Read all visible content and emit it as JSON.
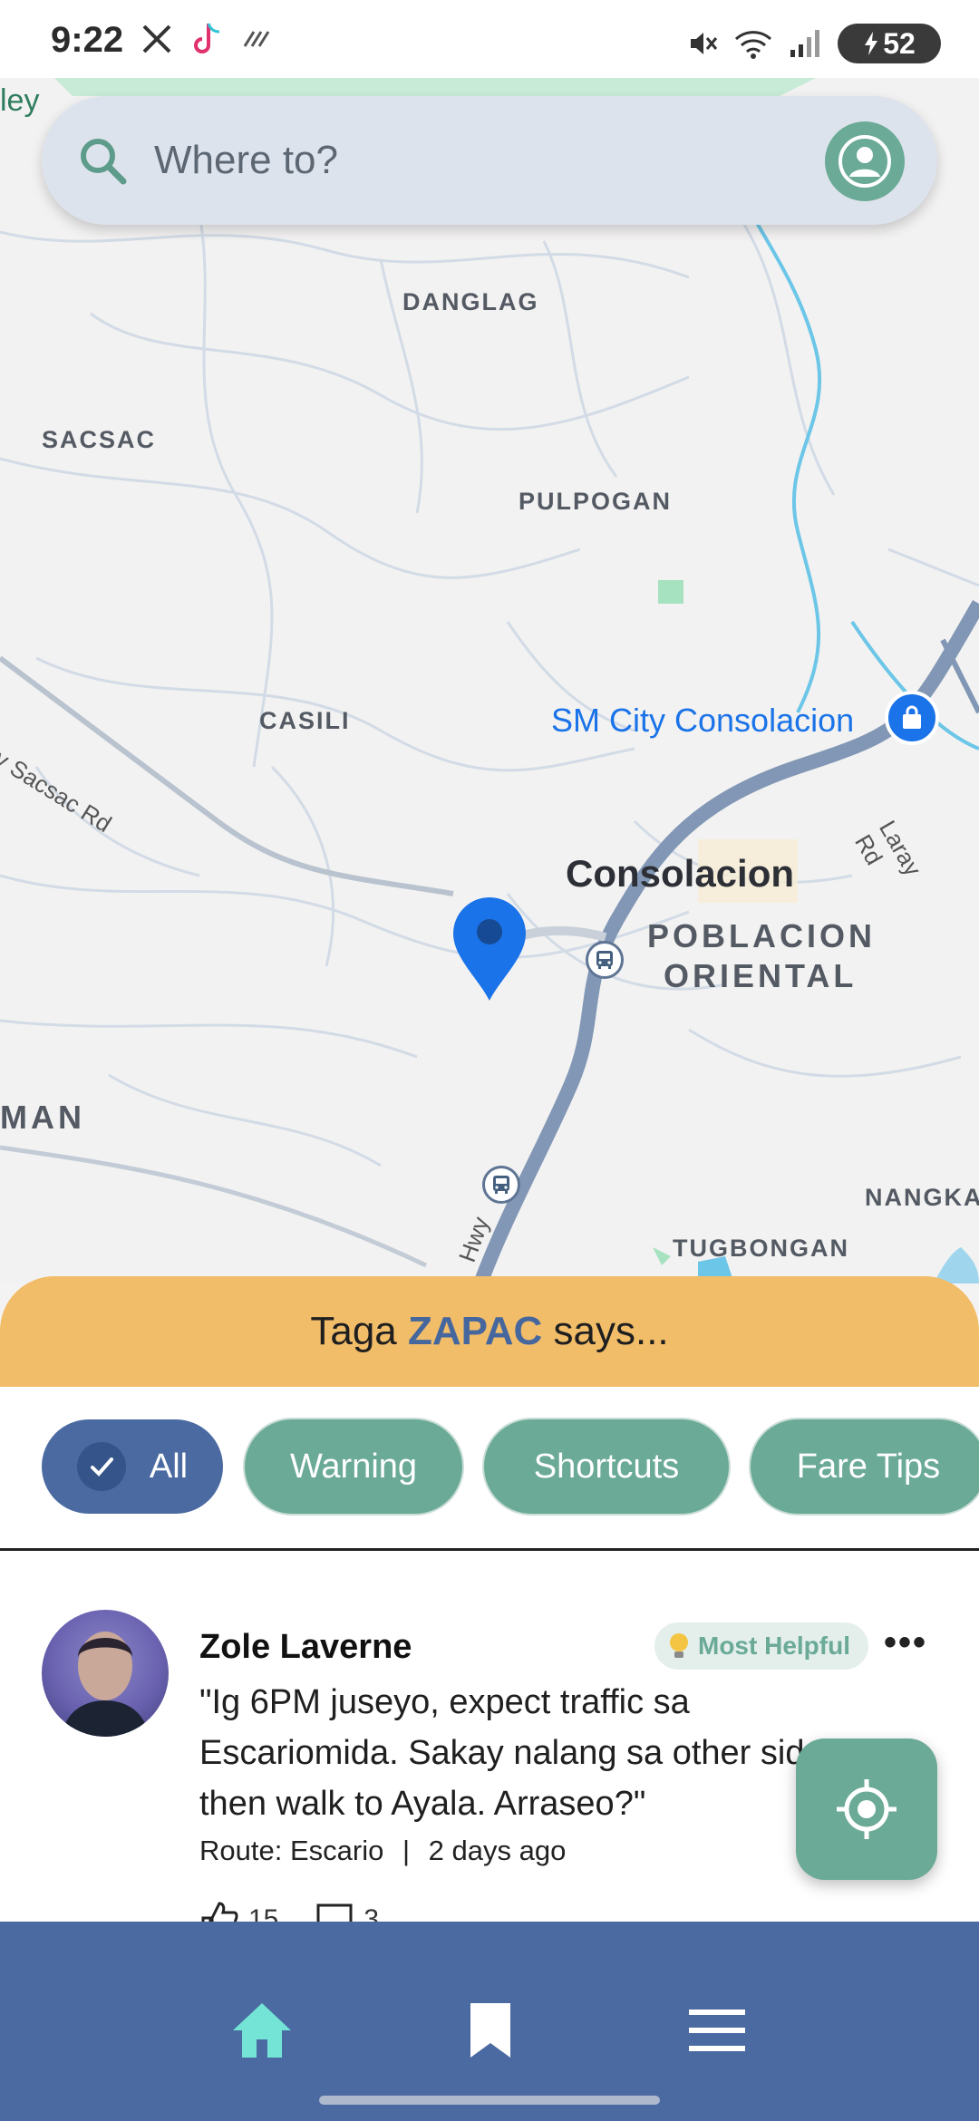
{
  "status_bar": {
    "time": "9:22",
    "battery": "52"
  },
  "search": {
    "placeholder": "Where to?"
  },
  "map": {
    "labels": {
      "valley": "ley",
      "danglag": "DANGLAG",
      "sacsac": "SACSAC",
      "pulpogan": "PULPOGAN",
      "casili": "CASILI",
      "sm_city": "SM City Consolacion",
      "sacsac_rd": "nay Sacsac Rd",
      "consolacion": "Consolacion",
      "poblacion": "POBLACION",
      "oriental": "ORIENTAL",
      "laray_rd": "Laray Rd",
      "man": "MAN",
      "nangka": "NANGKA",
      "tugbongan": "TUGBONGAN",
      "hwy": "Hwy"
    }
  },
  "sheet": {
    "prefix": "Taga ",
    "brand": "ZAPAC",
    "suffix": " says...",
    "chips": [
      "All",
      "Warning",
      "Shortcuts",
      "Fare Tips"
    ]
  },
  "post": {
    "author": "Zole Laverne",
    "badge": "Most Helpful",
    "text": "\"Ig 6PM juseyo, expect traffic sa Escariomida. Sakay nalang sa other side then walk to Ayala. Arraseo?\"",
    "route": "Route: Escario",
    "separator": "|",
    "time_ago": "2 days ago",
    "likes": "15",
    "comments": "3"
  },
  "colors": {
    "accent_green": "#6aaa96",
    "accent_blue": "#4a6aa1",
    "sheet_header": "#f2bd69"
  }
}
